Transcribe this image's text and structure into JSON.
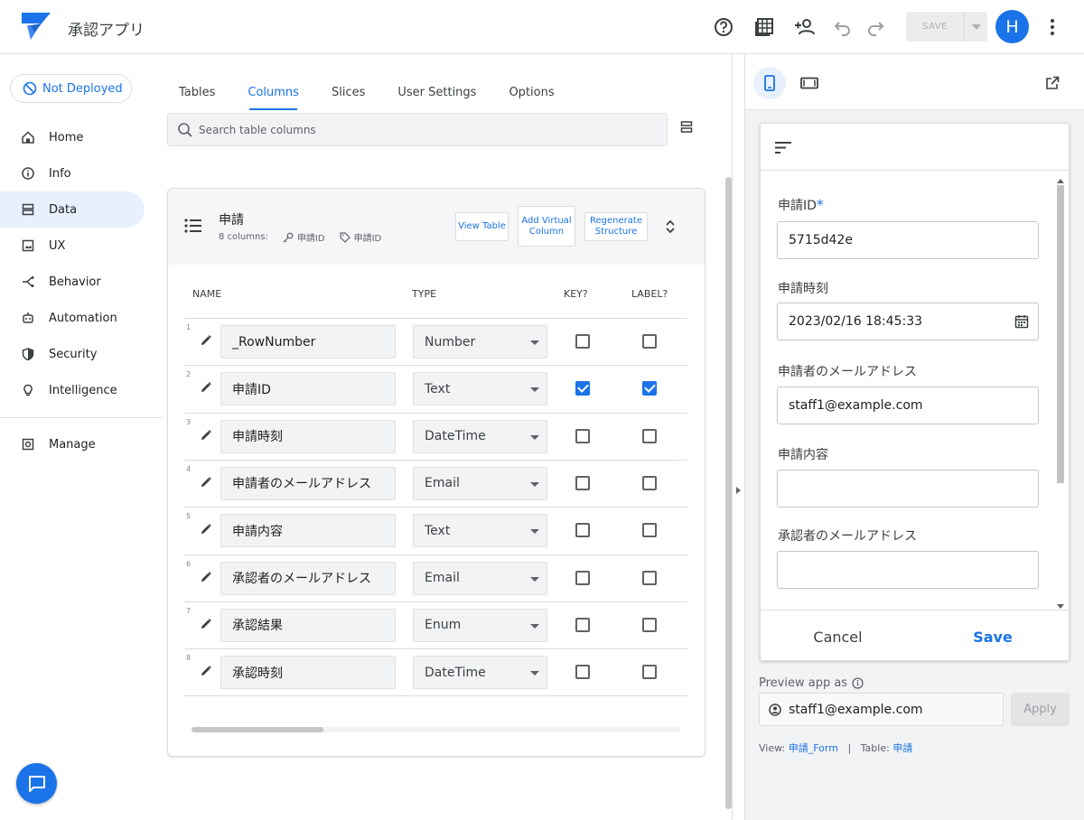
{
  "app": {
    "title": "承認アプリ"
  },
  "toolbar": {
    "save_label": "SAVE",
    "avatar_initial": "H"
  },
  "deploy": {
    "label": "Not Deployed"
  },
  "nav": {
    "items": [
      {
        "label": "Home",
        "icon": "home-icon"
      },
      {
        "label": "Info",
        "icon": "info-icon"
      },
      {
        "label": "Data",
        "icon": "data-icon",
        "active": true
      },
      {
        "label": "UX",
        "icon": "ux-icon"
      },
      {
        "label": "Behavior",
        "icon": "behavior-icon"
      },
      {
        "label": "Automation",
        "icon": "automation-icon"
      },
      {
        "label": "Security",
        "icon": "security-icon"
      },
      {
        "label": "Intelligence",
        "icon": "intelligence-icon"
      }
    ],
    "manage": "Manage"
  },
  "tabs": [
    {
      "label": "Tables"
    },
    {
      "label": "Columns",
      "active": true
    },
    {
      "label": "Slices"
    },
    {
      "label": "User Settings"
    },
    {
      "label": "Options"
    }
  ],
  "search": {
    "placeholder": "Search table columns"
  },
  "table": {
    "name": "申請",
    "count": "8 columns:",
    "key": "申請ID",
    "label": "申請ID",
    "buttons": {
      "view": "View Table",
      "add": "Add Virtual Column",
      "regen": "Regenerate Structure"
    },
    "headers": {
      "name": "NAME",
      "type": "TYPE",
      "key": "KEY?",
      "label": "LABEL?"
    },
    "rows": [
      {
        "num": "1",
        "name": "_RowNumber",
        "type": "Number",
        "key": false,
        "label": false
      },
      {
        "num": "2",
        "name": "申請ID",
        "type": "Text",
        "key": true,
        "label": true
      },
      {
        "num": "3",
        "name": "申請時刻",
        "type": "DateTime",
        "key": false,
        "label": false
      },
      {
        "num": "4",
        "name": "申請者のメールアドレス",
        "type": "Email",
        "key": false,
        "label": false
      },
      {
        "num": "5",
        "name": "申請内容",
        "type": "Text",
        "key": false,
        "label": false
      },
      {
        "num": "6",
        "name": "承認者のメールアドレス",
        "type": "Email",
        "key": false,
        "label": false
      },
      {
        "num": "7",
        "name": "承認結果",
        "type": "Enum",
        "key": false,
        "label": false
      },
      {
        "num": "8",
        "name": "承認時刻",
        "type": "DateTime",
        "key": false,
        "label": false
      }
    ]
  },
  "form": {
    "fields": [
      {
        "label": "申請ID",
        "required": "*",
        "value": "5715d42e"
      },
      {
        "label": "申請時刻",
        "value": "2023/02/16 18:45:33"
      },
      {
        "label": "申請者のメールアドレス",
        "value": "staff1@example.com"
      },
      {
        "label": "申請内容",
        "value": ""
      },
      {
        "label": "承認者のメールアドレス",
        "value": ""
      }
    ],
    "cancel": "Cancel",
    "save": "Save"
  },
  "preview": {
    "label": "Preview app as",
    "user": "staff1@example.com",
    "apply": "Apply",
    "view_prefix": "View:",
    "view_name": "申請_Form",
    "sep": "|",
    "table_prefix": "Table:",
    "table_name": "申請"
  },
  "colors": {
    "accent": "#1a73e8",
    "active_bg": "#e8f0fe"
  }
}
